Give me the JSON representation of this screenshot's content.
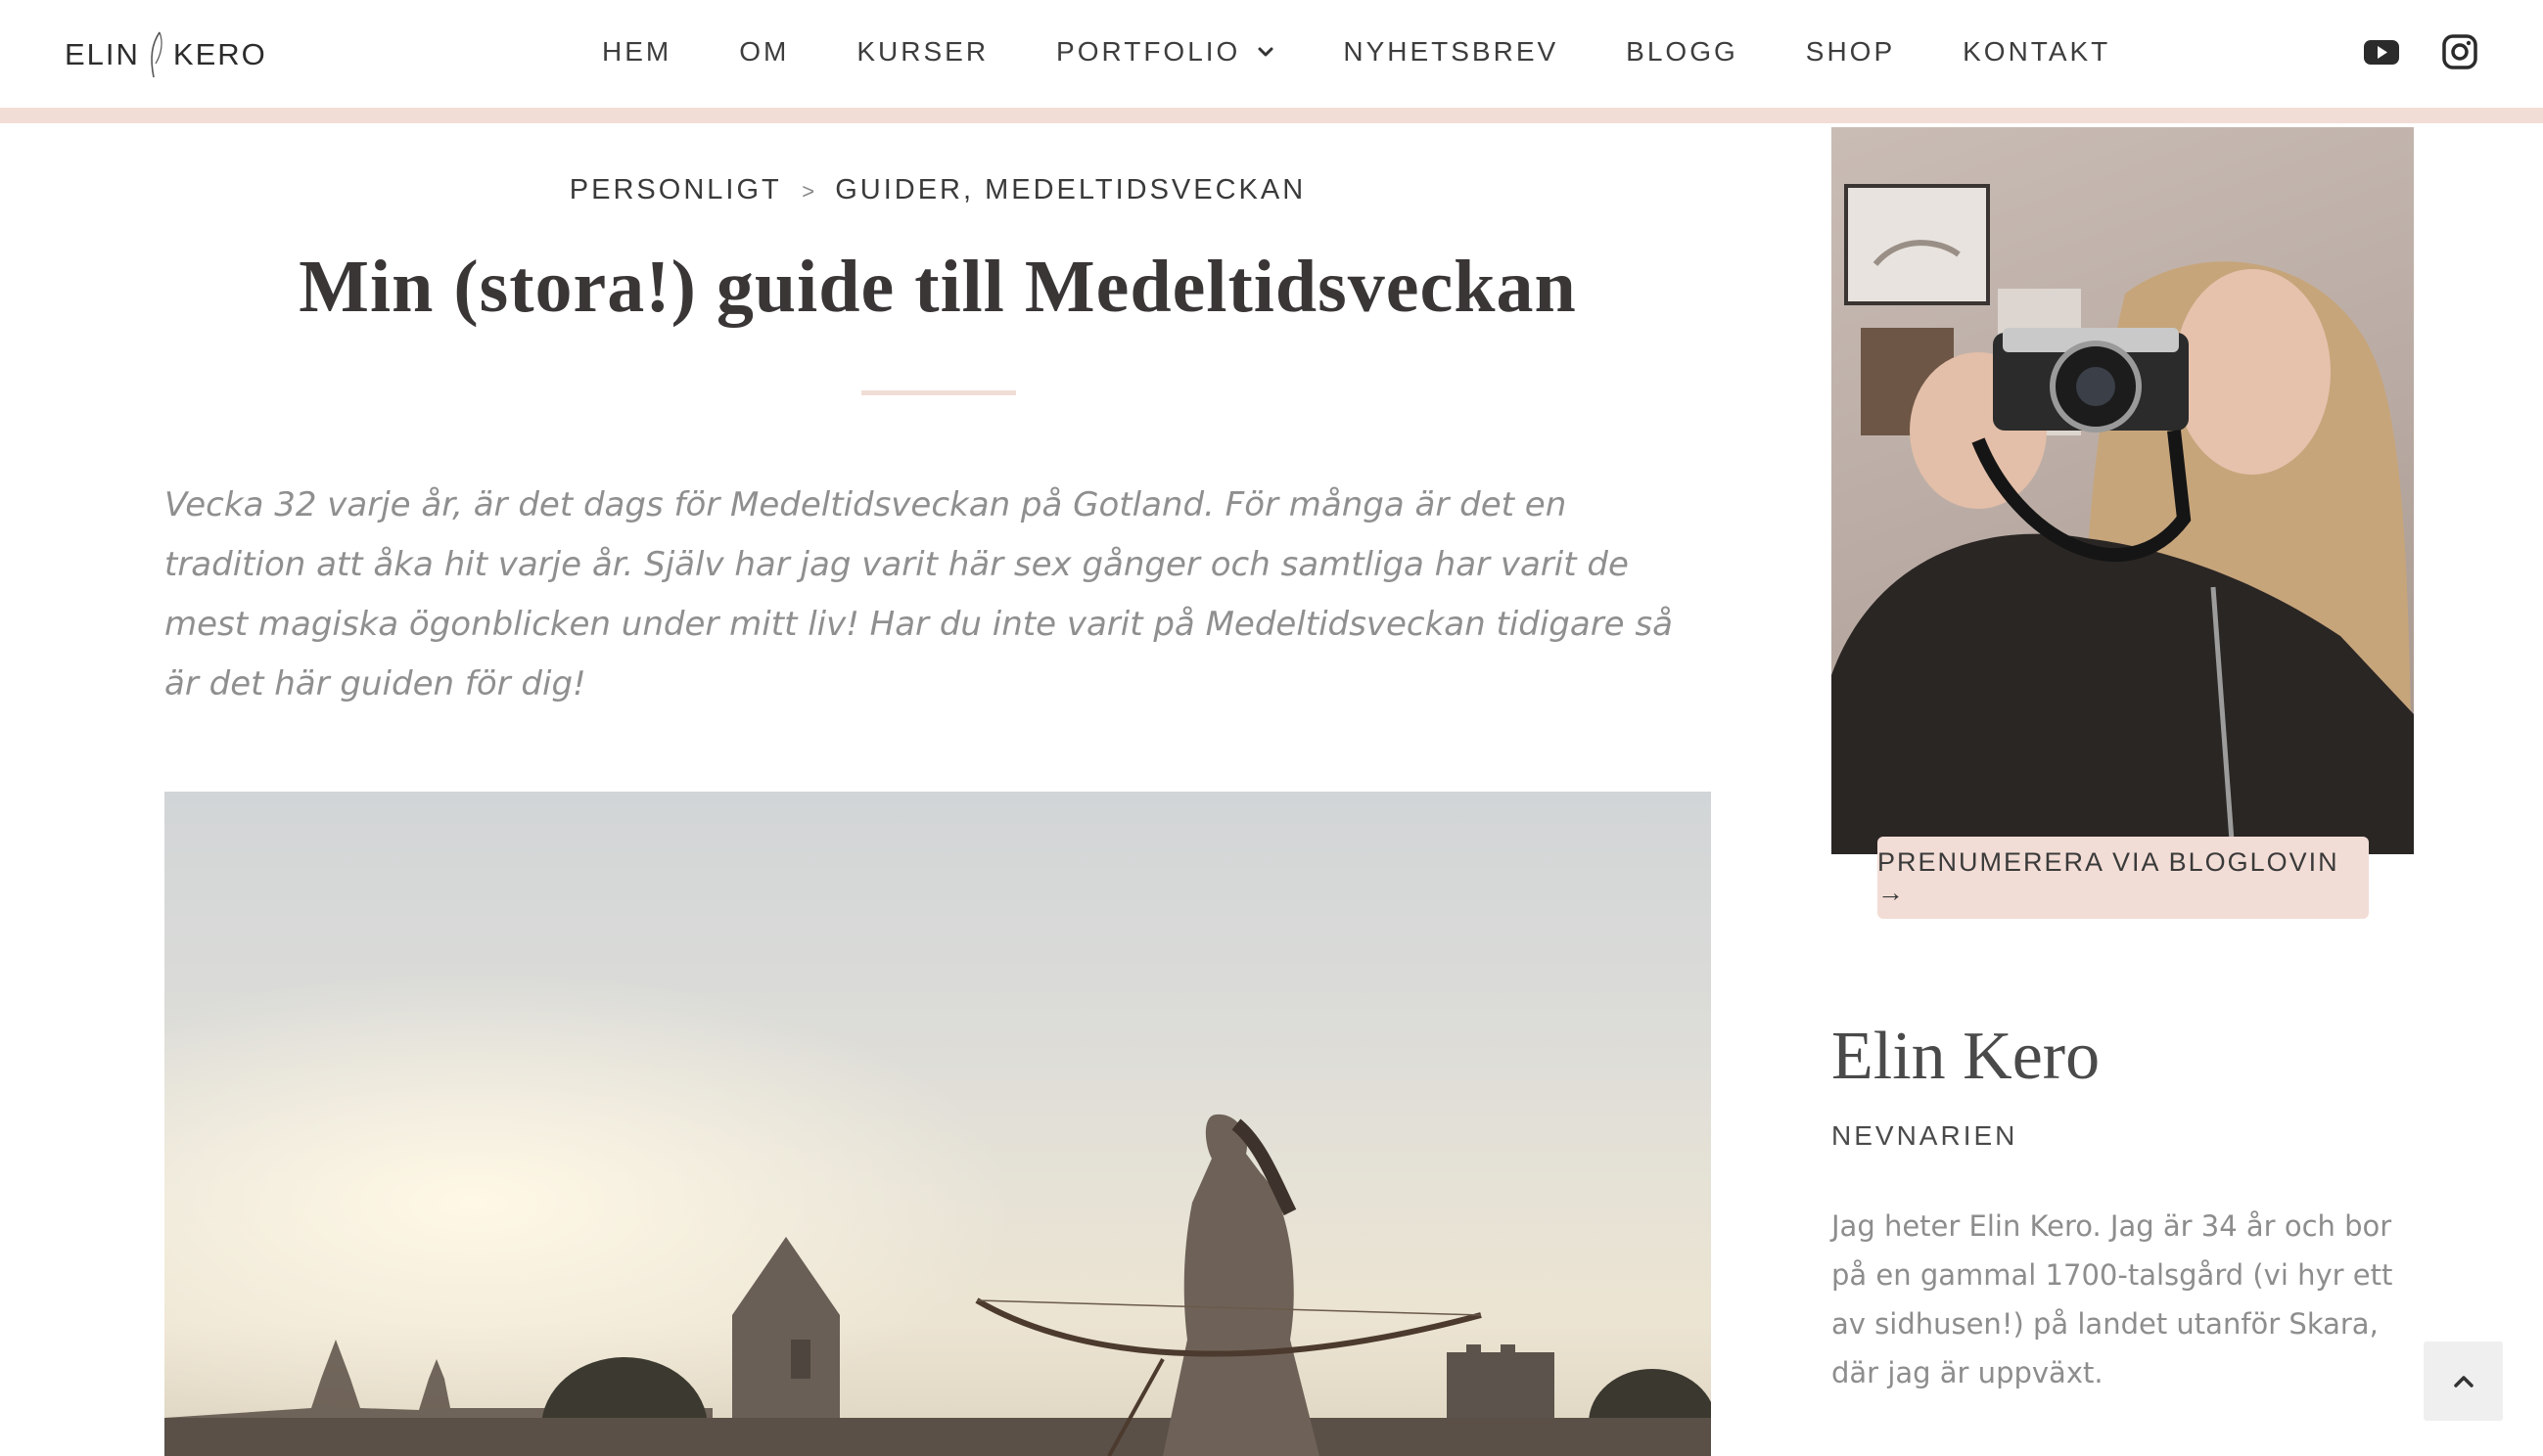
{
  "header": {
    "logo_left": "ELIN",
    "logo_right": "KERO",
    "nav": [
      {
        "label": "HEM"
      },
      {
        "label": "OM"
      },
      {
        "label": "KURSER"
      },
      {
        "label": "PORTFOLIO"
      },
      {
        "label": "NYHETSBREV"
      },
      {
        "label": "BLOGG"
      },
      {
        "label": "SHOP"
      },
      {
        "label": "KONTAKT"
      }
    ],
    "social": [
      "youtube-icon",
      "instagram-icon"
    ]
  },
  "article": {
    "breadcrumb": {
      "parent": "PERSONLIGT",
      "separator": ">",
      "cat1": "GUIDER",
      "comma": ",",
      "cat2": "MEDELTIDSVECKAN"
    },
    "title": "Min (stora!) guide till Medeltidsveckan",
    "lead": "Vecka 32 varje år, är det dags för Medeltidsveckan på Gotland. För många är det en tradition att åka hit varje år. Själv har jag varit här sex gånger och samtliga har varit de mest magiska ögonblicken under mitt liv! Har du inte varit på Medeltidsveckan tidigare så är det här guiden för dig!"
  },
  "sidebar": {
    "subscribe_label": "PRENUMERERA VIA BLOGLOVIN →",
    "author_name": "Elin Kero",
    "author_tag": "NEVNARIEN",
    "bio": "Jag heter Elin Kero. Jag är 34 år och bor på en gammal 1700-talsgård (vi hyr ett av sidhusen!) på landet utanför Skara, där jag är uppväxt."
  },
  "colors": {
    "accent": "#f2ddd6",
    "text": "#3a3a3a",
    "muted": "#8d8d8d"
  }
}
